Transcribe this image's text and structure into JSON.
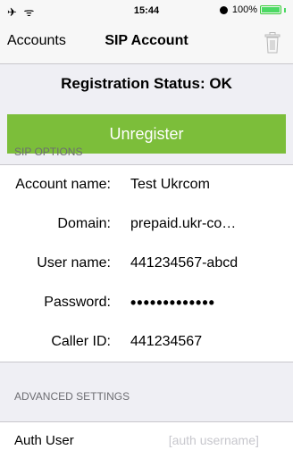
{
  "status_bar": {
    "time": "15:44",
    "battery": "100%",
    "battery_level": 1.0,
    "signal_glyphs": "✈ ᯤ"
  },
  "nav": {
    "back_label": "Accounts",
    "title": "SIP Account",
    "trash_icon": "trash-icon"
  },
  "registration": {
    "status_text": "Registration Status: OK"
  },
  "unregister": {
    "label": "Unregister",
    "color": "#7cbe3a"
  },
  "sections": {
    "sip_options": "SIP OPTIONS",
    "advanced": "ADVANCED SETTINGS"
  },
  "sip_options": [
    {
      "label": "Account name:",
      "value": "Test Ukrcom"
    },
    {
      "label": "Domain:",
      "value": "prepaid.ukr-co…"
    },
    {
      "label": "User name:",
      "value": "441234567-abcd"
    },
    {
      "label": "Password:",
      "value": "•••••••••••••"
    },
    {
      "label": "Caller ID:",
      "value": "441234567"
    }
  ],
  "advanced_settings": {
    "auth_user_label": "Auth User",
    "auth_user_placeholder": "[auth username]"
  }
}
